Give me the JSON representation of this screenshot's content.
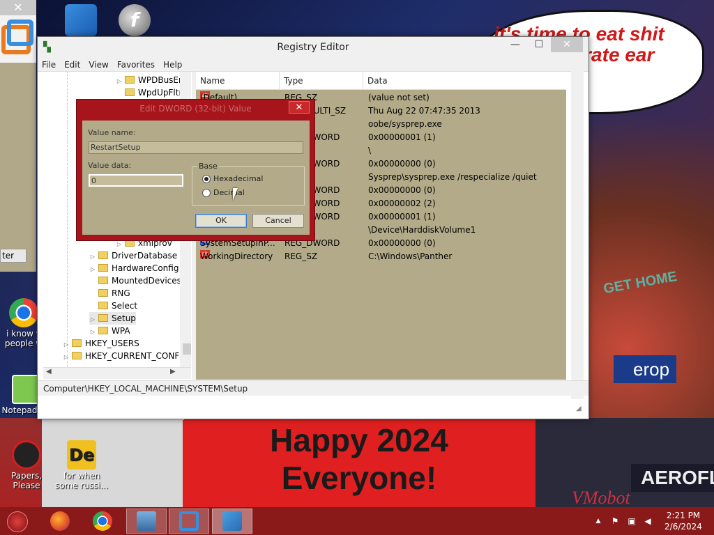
{
  "wallpaper": {
    "bubble_text": "it's time to eat shit and celebrate ear",
    "banner_line1": "Happy 2024",
    "banner_line2": "Everyone!",
    "sign_gethome": "GET HOME",
    "sign_erop": "erop",
    "sign_aero": "AEROFL",
    "watermark": "VMobot"
  },
  "left_window": {
    "close_glyph": "✕",
    "button_label": "ter"
  },
  "desktop_icons": [
    {
      "name": "vmware-workstation",
      "label": ""
    },
    {
      "name": "adobe-flash",
      "label": ""
    },
    {
      "name": "chrome",
      "label": "i know y people w"
    },
    {
      "name": "notepad-plus-plus",
      "label": "Notepad++"
    },
    {
      "name": "papers-please",
      "label": "Papers, Please"
    },
    {
      "name": "de-shortcut",
      "label": "for when some russi..."
    }
  ],
  "registry_editor": {
    "title": "Registry Editor",
    "controls": {
      "minimize": "—",
      "maximize": "☐",
      "close": "✕"
    },
    "menu": [
      "File",
      "Edit",
      "View",
      "Favorites",
      "Help"
    ],
    "tree": [
      {
        "label": "WPDBusEn",
        "indent": 3
      },
      {
        "label": "WpdUpFltr",
        "indent": 3
      },
      {
        "label": "xmlprov",
        "indent": 3
      },
      {
        "label": "DriverDatabase",
        "indent": 2
      },
      {
        "label": "HardwareConfig",
        "indent": 2
      },
      {
        "label": "MountedDevices",
        "indent": 2
      },
      {
        "label": "RNG",
        "indent": 2
      },
      {
        "label": "Select",
        "indent": 2
      },
      {
        "label": "Setup",
        "indent": 2
      },
      {
        "label": "WPA",
        "indent": 2
      },
      {
        "label": "HKEY_USERS",
        "indent": 1
      },
      {
        "label": "HKEY_CURRENT_CONFIG",
        "indent": 1
      }
    ],
    "columns": [
      "Name",
      "Type",
      "Data"
    ],
    "rows": [
      {
        "name": "(Default)",
        "type": "REG_SZ",
        "data": "(value not set)",
        "icon": "ab"
      },
      {
        "name": "",
        "type": "REG_MULTI_SZ",
        "data": "Thu Aug 22 07:47:35 2013",
        "icon": ""
      },
      {
        "name": "",
        "type": "",
        "data": "oobe/sysprep.exe",
        "icon": ""
      },
      {
        "name": "",
        "type": "REG_DWORD",
        "data": "0x00000001 (1)",
        "icon": ""
      },
      {
        "name": "",
        "type": "",
        "data": "\\",
        "icon": ""
      },
      {
        "name": "",
        "type": "REG_DWORD",
        "data": "0x00000000 (0)",
        "icon": ""
      },
      {
        "name": "",
        "type": "",
        "data": "Sysprep\\sysprep.exe /respecialize /quiet",
        "icon": ""
      },
      {
        "name": "",
        "type": "REG_DWORD",
        "data": "0x00000000 (0)",
        "icon": ""
      },
      {
        "name": "",
        "type": "REG_DWORD",
        "data": "0x00000002 (2)",
        "icon": ""
      },
      {
        "name": "",
        "type": "REG_DWORD",
        "data": "0x00000001 (1)",
        "icon": ""
      },
      {
        "name": "",
        "type": "",
        "data": "\\Device\\HarddiskVolume1",
        "icon": ""
      },
      {
        "name": "SystemSetupInP...",
        "type": "REG_DWORD",
        "data": "0x00000000 (0)",
        "icon": "bin"
      },
      {
        "name": "WorkingDirectory",
        "type": "REG_SZ",
        "data": "C:\\Windows\\Panther",
        "icon": "ab"
      }
    ],
    "status_path": "Computer\\HKEY_LOCAL_MACHINE\\SYSTEM\\Setup"
  },
  "dialog": {
    "title": "Edit DWORD (32-bit) Value",
    "close_glyph": "✕",
    "value_name_label": "Value name:",
    "value_name": "RestartSetup",
    "value_data_label": "Value data:",
    "value_data": "0",
    "base_label": "Base",
    "radio_hex": "Hexadecimal",
    "radio_dec": "Decimal",
    "selected_base": "Hexadecimal",
    "ok": "OK",
    "cancel": "Cancel"
  },
  "taskbar": {
    "apps": [
      "firefox",
      "chrome",
      "network-remote",
      "vmware",
      "registry-editor"
    ],
    "tray_up": "▲",
    "clock_time": "2:21 PM",
    "clock_date": "2/6/2024"
  }
}
